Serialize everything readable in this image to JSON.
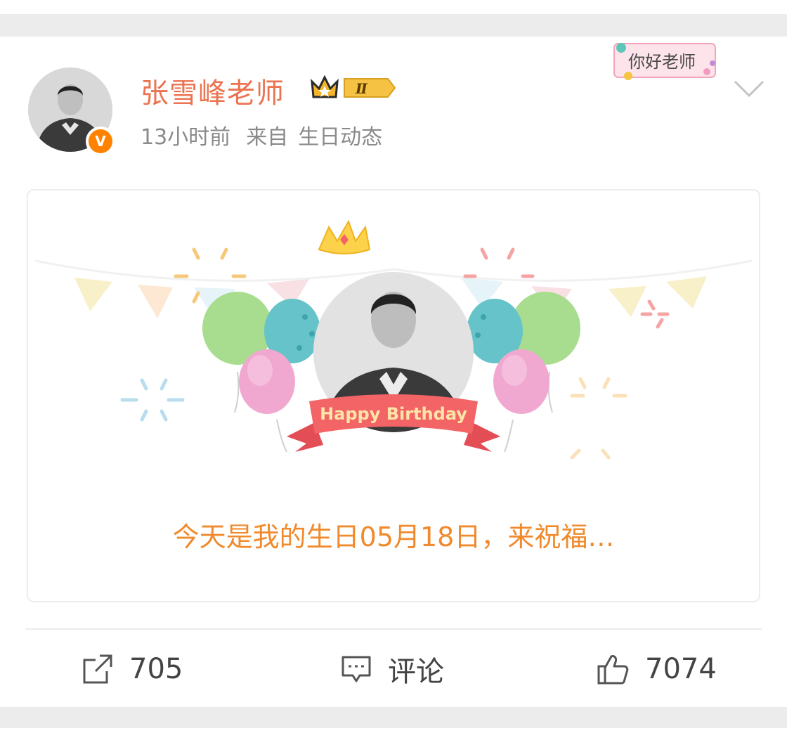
{
  "post": {
    "author": "张雪峰老师",
    "badge_level": "Ⅱ",
    "time": "13小时前",
    "source_prefix": "来自",
    "source": "生日动态",
    "sticker_text": "你好老师"
  },
  "birthday_card": {
    "banner_text": "Happy Birthday",
    "caption": "今天是我的生日05月18日，来祝福…"
  },
  "actions": {
    "repost_count": "705",
    "comment_label": "评论",
    "like_count": "7074"
  },
  "colors": {
    "username": "#eb7350",
    "verified": "#ff8200",
    "caption": "#f08a2c",
    "ribbon": "#f26466"
  }
}
